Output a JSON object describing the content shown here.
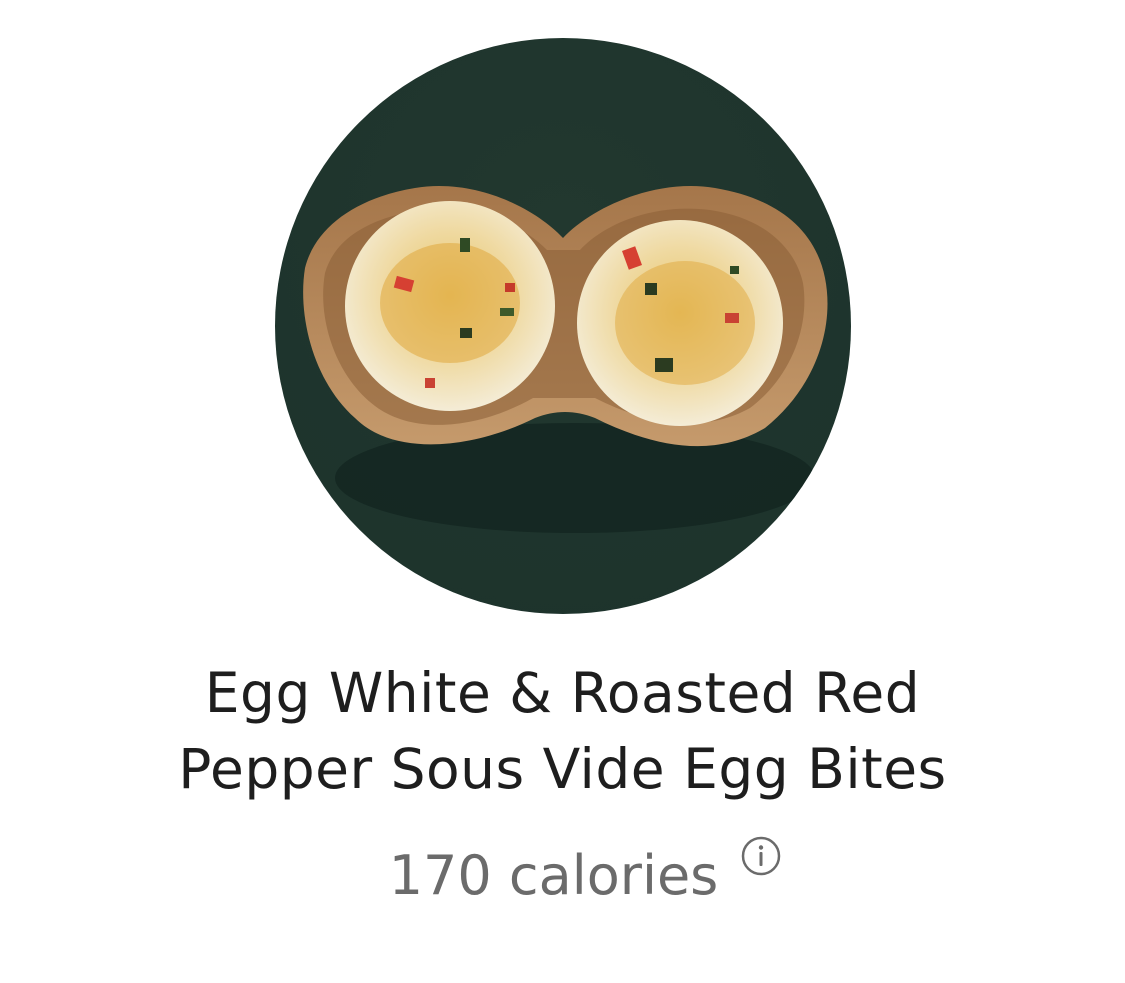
{
  "product": {
    "image_icon": "egg-bites-photo",
    "background_color": "#1f3530",
    "title_line1": "Egg White & Roasted Red",
    "title_line2": "Pepper Sous Vide Egg Bites",
    "calories": "170 calories",
    "info_icon": "info-circle-icon"
  }
}
